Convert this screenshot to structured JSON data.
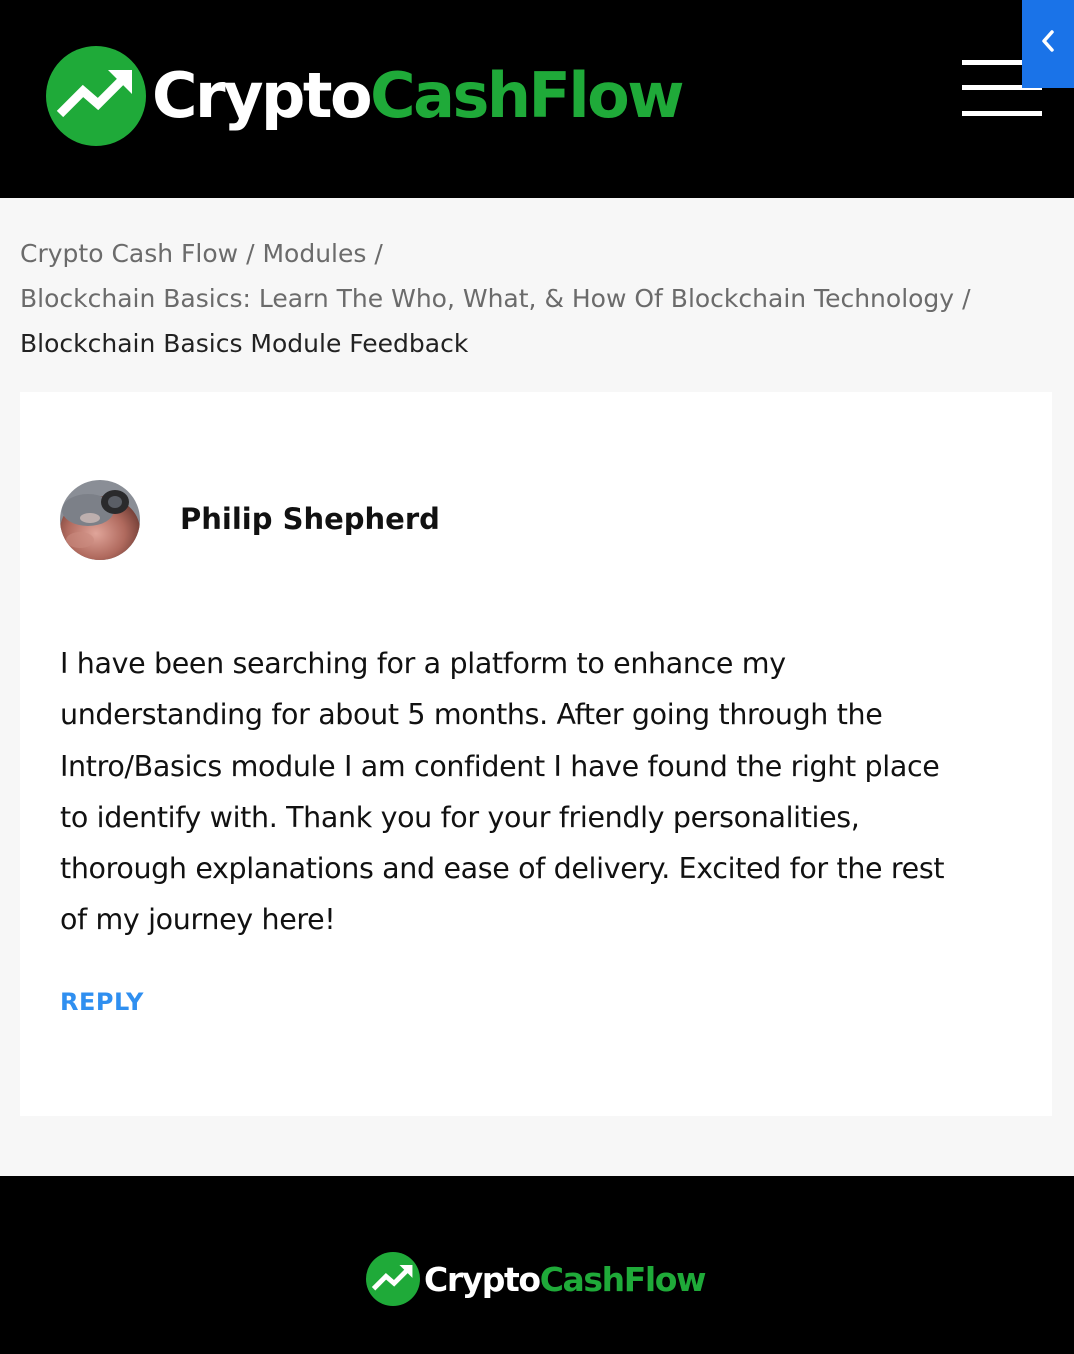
{
  "header": {
    "logo": {
      "word1": "Crypto",
      "word2": "CashFlow",
      "icon": "trending-up-icon"
    },
    "menu_icon": "hamburger-menu-icon",
    "side_tab_icon": "chevron-left-icon"
  },
  "breadcrumb": {
    "items": [
      {
        "label": "Crypto Cash Flow"
      },
      {
        "label": "Modules"
      },
      {
        "label": "Blockchain Basics: Learn The Who, What, & How Of Blockchain Technology"
      },
      {
        "label": "Blockchain Basics Module Feedback"
      }
    ],
    "separator": "/"
  },
  "comment": {
    "author": "Philip Shepherd",
    "lines": [
      "I have been searching for a platform to enhance my",
      "understanding for about 5 months. After going through the",
      "Intro/Basics module I am confident I have found the right place",
      "to identify with. Thank you for your friendly personalities,",
      "thorough explanations and ease of delivery. Excited for the rest",
      "of my journey here!"
    ],
    "reply_label": "REPLY"
  },
  "footer": {
    "logo": {
      "word1": "Crypto",
      "word2": "CashFlow",
      "icon": "trending-up-icon"
    }
  },
  "colors": {
    "brand_green": "#1faa39",
    "header_bg": "#000000",
    "link_blue": "#2f8ff0",
    "side_tab_blue": "#1a73e8"
  }
}
